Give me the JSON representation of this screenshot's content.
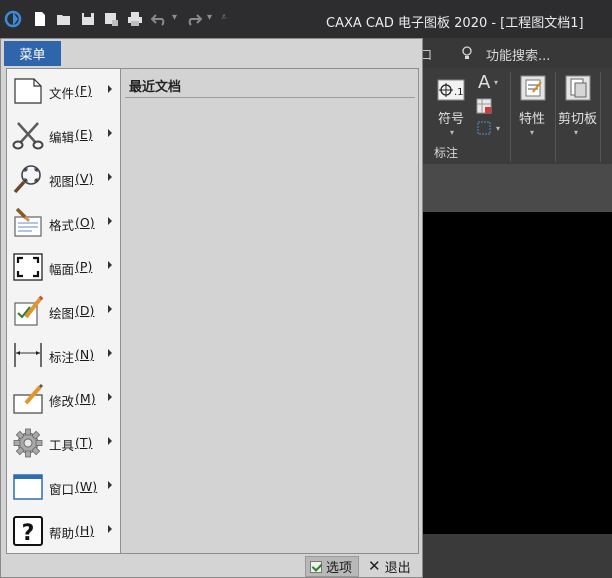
{
  "window": {
    "title": "CAXA CAD 电子图板 2020 - [工程图文档1]"
  },
  "ribbon": {
    "partial_tab": "口",
    "search_label": "功能搜索...",
    "buttons": {
      "symbol": "符号",
      "properties": "特性",
      "clipboard": "剪切板"
    },
    "group_label": "标注"
  },
  "menu": {
    "tab_label": "菜单",
    "items": [
      {
        "label": "文件",
        "hotkey": "F",
        "icon": "document-icon"
      },
      {
        "label": "编辑",
        "hotkey": "E",
        "icon": "scissors-icon"
      },
      {
        "label": "视图",
        "hotkey": "V",
        "icon": "zoom-view-icon"
      },
      {
        "label": "格式",
        "hotkey": "O",
        "icon": "format-brush-icon"
      },
      {
        "label": "幅面",
        "hotkey": "P",
        "icon": "sheet-frame-icon"
      },
      {
        "label": "绘图",
        "hotkey": "D",
        "icon": "draw-pencil-icon"
      },
      {
        "label": "标注",
        "hotkey": "N",
        "icon": "dimension-icon"
      },
      {
        "label": "修改",
        "hotkey": "M",
        "icon": "modify-icon"
      },
      {
        "label": "工具",
        "hotkey": "T",
        "icon": "gear-icon"
      },
      {
        "label": "窗口",
        "hotkey": "W",
        "icon": "window-icon"
      },
      {
        "label": "帮助",
        "hotkey": "H",
        "icon": "help-icon"
      }
    ],
    "recent_title": "最近文档",
    "options_label": "选项",
    "exit_label": "退出"
  }
}
